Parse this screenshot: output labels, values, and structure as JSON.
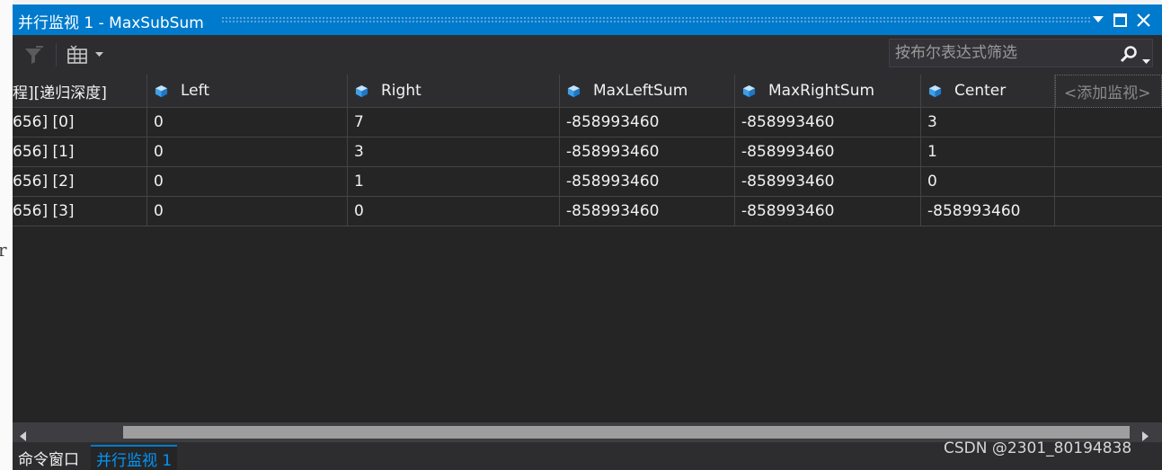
{
  "window": {
    "title": "并行监视 1 - MaxSubSum",
    "accent_color": "#007acc"
  },
  "toolbar": {
    "filter_icon": "filter-icon",
    "columns_icon": "grid-columns-icon",
    "search": {
      "placeholder": "按布尔表达式筛选",
      "value": ""
    }
  },
  "grid": {
    "columns": [
      {
        "label": "程][递归深度]",
        "icon": ""
      },
      {
        "label": "Left",
        "icon": "variable-cube-icon"
      },
      {
        "label": "Right",
        "icon": "variable-cube-icon"
      },
      {
        "label": "MaxLeftSum",
        "icon": "variable-cube-icon"
      },
      {
        "label": "MaxRightSum",
        "icon": "variable-cube-icon"
      },
      {
        "label": "Center",
        "icon": "variable-cube-icon"
      }
    ],
    "add_watch_label": "<添加监视>",
    "rows": [
      [
        "656]  [0]",
        "0",
        "7",
        "-858993460",
        "-858993460",
        "3"
      ],
      [
        "656]  [1]",
        "0",
        "3",
        "-858993460",
        "-858993460",
        "1"
      ],
      [
        "656]  [2]",
        "0",
        "1",
        "-858993460",
        "-858993460",
        "0"
      ],
      [
        "656]  [3]",
        "0",
        "0",
        "-858993460",
        "-858993460",
        "-858993460"
      ]
    ]
  },
  "tabs": [
    {
      "label": "命令窗口",
      "active": false
    },
    {
      "label": "并行监视 1",
      "active": true
    }
  ],
  "watermark": "CSDN @2301_80194838",
  "background_glyph": "r"
}
